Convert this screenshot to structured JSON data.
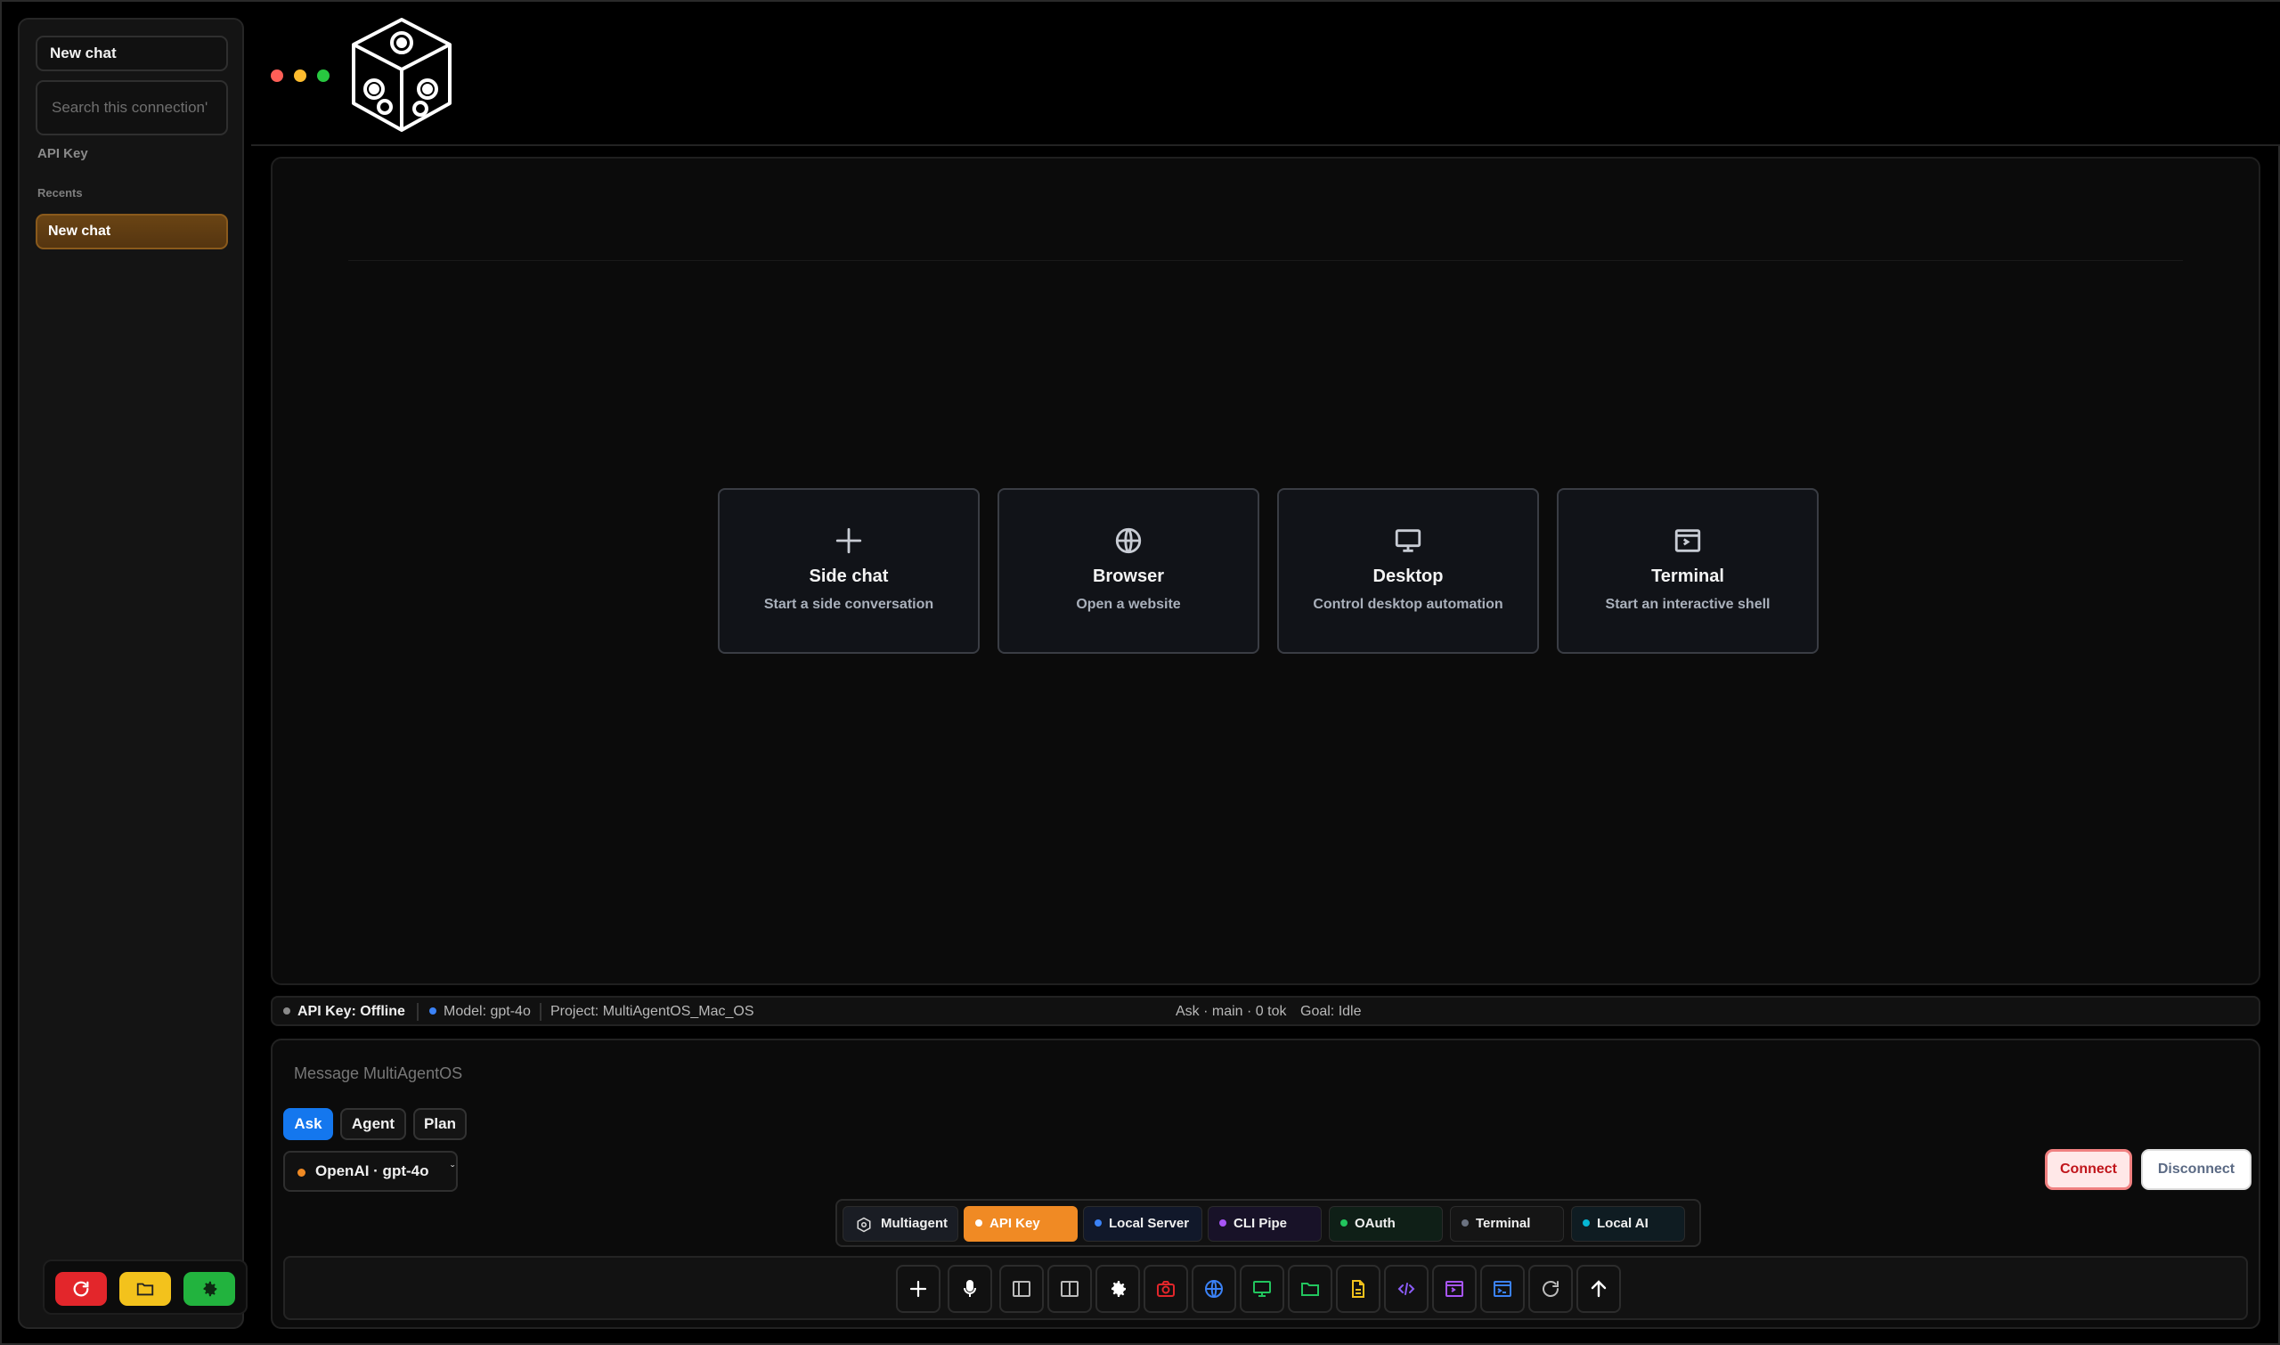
{
  "window": {
    "traffic_lights": [
      "#ff5f57",
      "#febc2e",
      "#28c840"
    ]
  },
  "sidebar": {
    "new_chat_label": "New chat",
    "search_placeholder": "Search this connection'",
    "connection_label": "API Key",
    "recents_label": "Recents",
    "recent_items": [
      {
        "label": "New chat",
        "active": true
      }
    ],
    "bottom_buttons": [
      {
        "icon": "refresh-icon",
        "color": "#e3262b"
      },
      {
        "icon": "folder-icon",
        "color": "#f3c21c"
      },
      {
        "icon": "gear-icon",
        "color": "#22b33e"
      }
    ]
  },
  "cards": [
    {
      "icon": "plus-icon",
      "title": "Side chat",
      "subtitle": "Start a side conversation"
    },
    {
      "icon": "globe-icon",
      "title": "Browser",
      "subtitle": "Open a website"
    },
    {
      "icon": "monitor-icon",
      "title": "Desktop",
      "subtitle": "Control desktop automation"
    },
    {
      "icon": "terminal-icon",
      "title": "Terminal",
      "subtitle": "Start an interactive shell"
    }
  ],
  "status": {
    "connection": "API Key: Offline",
    "connection_dot": "#8a8a8a",
    "model": "Model: gpt-4o",
    "model_dot": "#3b82f6",
    "project": "Project: MultiAgentOS_Mac_OS",
    "right_info": "Ask · main · 0 tok",
    "goal": "Goal: Idle"
  },
  "composer": {
    "placeholder": "Message MultiAgentOS",
    "modes": [
      {
        "label": "Ask",
        "active": true
      },
      {
        "label": "Agent",
        "active": false
      },
      {
        "label": "Plan",
        "active": false
      }
    ],
    "model_selector": "OpenAI · gpt-4o",
    "model_selector_chevron": "ˇ",
    "connect_label": "Connect",
    "disconnect_label": "Disconnect"
  },
  "connections": [
    {
      "label": "Multiagent",
      "icon": "multiagent-icon",
      "active": false
    },
    {
      "label": "API Key",
      "dot": "#ffffff",
      "active": true
    },
    {
      "label": "Local Server",
      "dot": "#3b82f6",
      "active": false
    },
    {
      "label": "CLI Pipe",
      "dot": "#a855f7",
      "active": false
    },
    {
      "label": "OAuth",
      "dot": "#22c55e",
      "active": false
    },
    {
      "label": "Terminal",
      "dot": "#6b7280",
      "active": false
    },
    {
      "label": "Local AI",
      "dot": "#06b6d4",
      "active": false
    }
  ],
  "tools": [
    {
      "icon": "plus-icon",
      "color": "#ffffff"
    },
    {
      "icon": "microphone-icon",
      "color": "#ffffff"
    },
    {
      "icon": "split-left-icon",
      "color": "#bbbbbb"
    },
    {
      "icon": "split-right-icon",
      "color": "#bbbbbb"
    },
    {
      "icon": "gear-icon",
      "color": "#ffffff"
    },
    {
      "icon": "camera-icon",
      "color": "#e3262b"
    },
    {
      "icon": "globe-icon",
      "color": "#3b82f6"
    },
    {
      "icon": "monitor-icon",
      "color": "#22c55e"
    },
    {
      "icon": "folder-icon",
      "color": "#22c55e"
    },
    {
      "icon": "file-icon",
      "color": "#f3c21c"
    },
    {
      "icon": "code-icon",
      "color": "#8b5cf6"
    },
    {
      "icon": "terminal-icon",
      "color": "#a855f7"
    },
    {
      "icon": "console-icon",
      "color": "#3b82f6"
    },
    {
      "icon": "refresh-icon",
      "color": "#bbbbbb"
    },
    {
      "icon": "arrow-up-icon",
      "color": "#ffffff"
    }
  ]
}
